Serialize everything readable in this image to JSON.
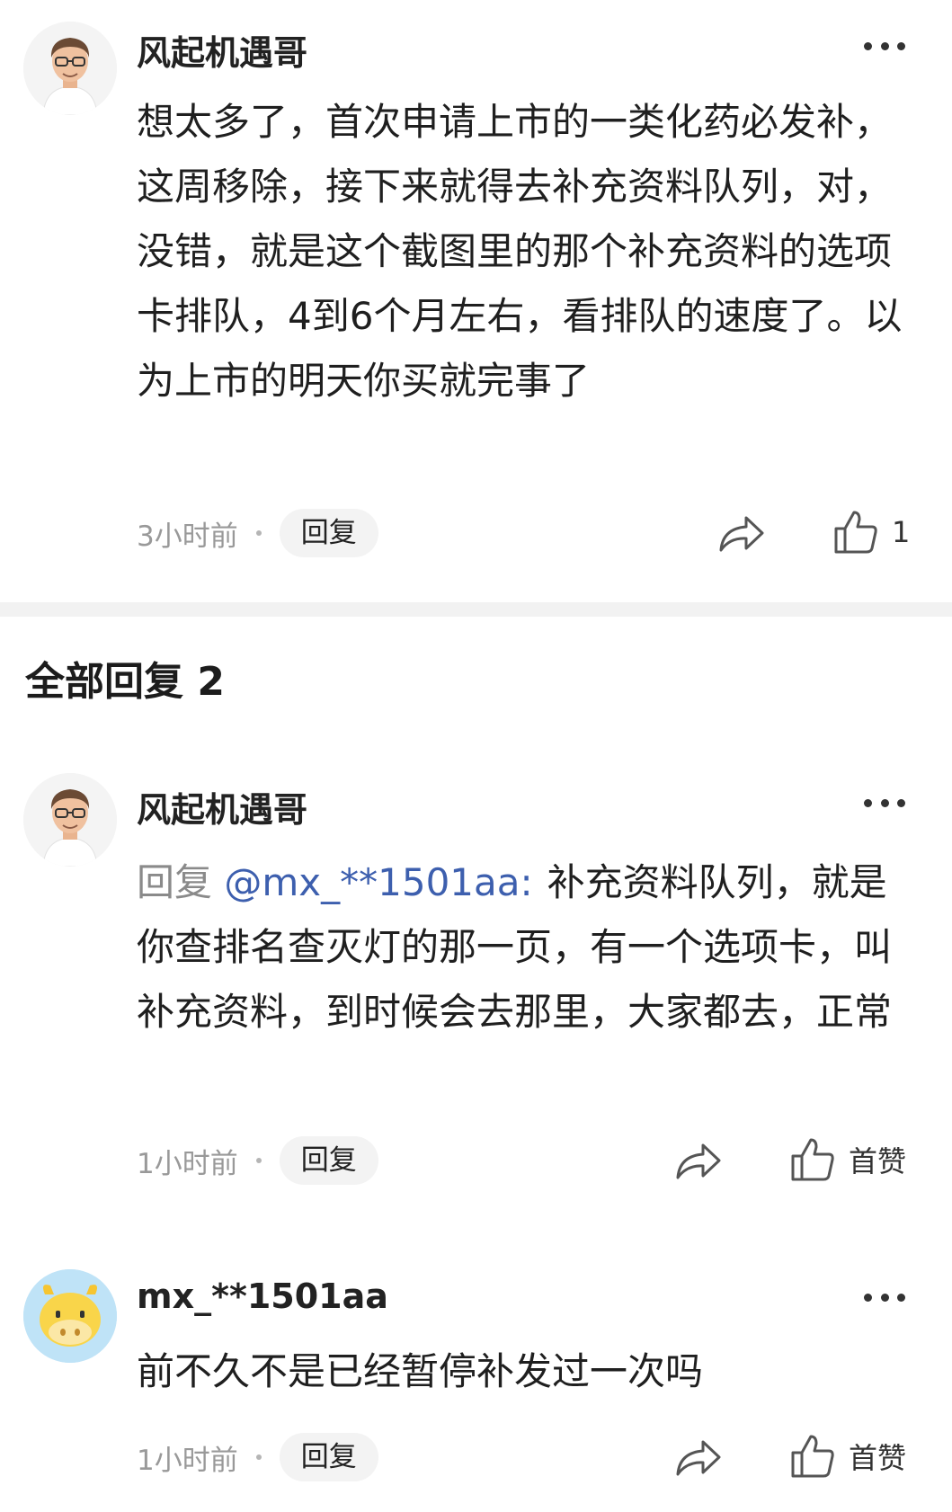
{
  "comments": [
    {
      "author": "风起机遇哥",
      "text": "想太多了，首次申请上市的一类化药必发补，这周移除，接下来就得去补充资料队列，对，没错，就是这个截图里的那个补充资料的选项卡排队，4到6个月左右，看排队的速度了。以为上市的明天你买就完事了",
      "time": "3小时前",
      "reply_label": "回复",
      "like_value": "1",
      "avatar_icon": "man-with-glasses-avatar"
    }
  ],
  "section": {
    "title": "全部回复 2"
  },
  "replies": [
    {
      "author": "风起机遇哥",
      "reply_prefix": "回复",
      "mention": "@mx_**1501aa:",
      "text": "补充资料队列，就是你查排名查灭灯的那一页，有一个选项卡，叫补充资料，到时候会去那里，大家都去，正常",
      "time": "1小时前",
      "reply_label": "回复",
      "like_label": "首赞",
      "avatar_icon": "man-with-glasses-avatar"
    },
    {
      "author": "mx_**1501aa",
      "text": "前不久不是已经暂停补发过一次吗",
      "time": "1小时前",
      "reply_label": "回复",
      "like_label": "首赞",
      "avatar_icon": "yellow-cow-avatar"
    }
  ],
  "icons": {
    "more": "more-dots-icon",
    "share": "share-arrow-icon",
    "like": "thumbs-up-icon"
  },
  "colors": {
    "mention": "#3d5fae",
    "divider": "#f2f2f2",
    "cow_avatar_bg": "#bfe3f7"
  }
}
